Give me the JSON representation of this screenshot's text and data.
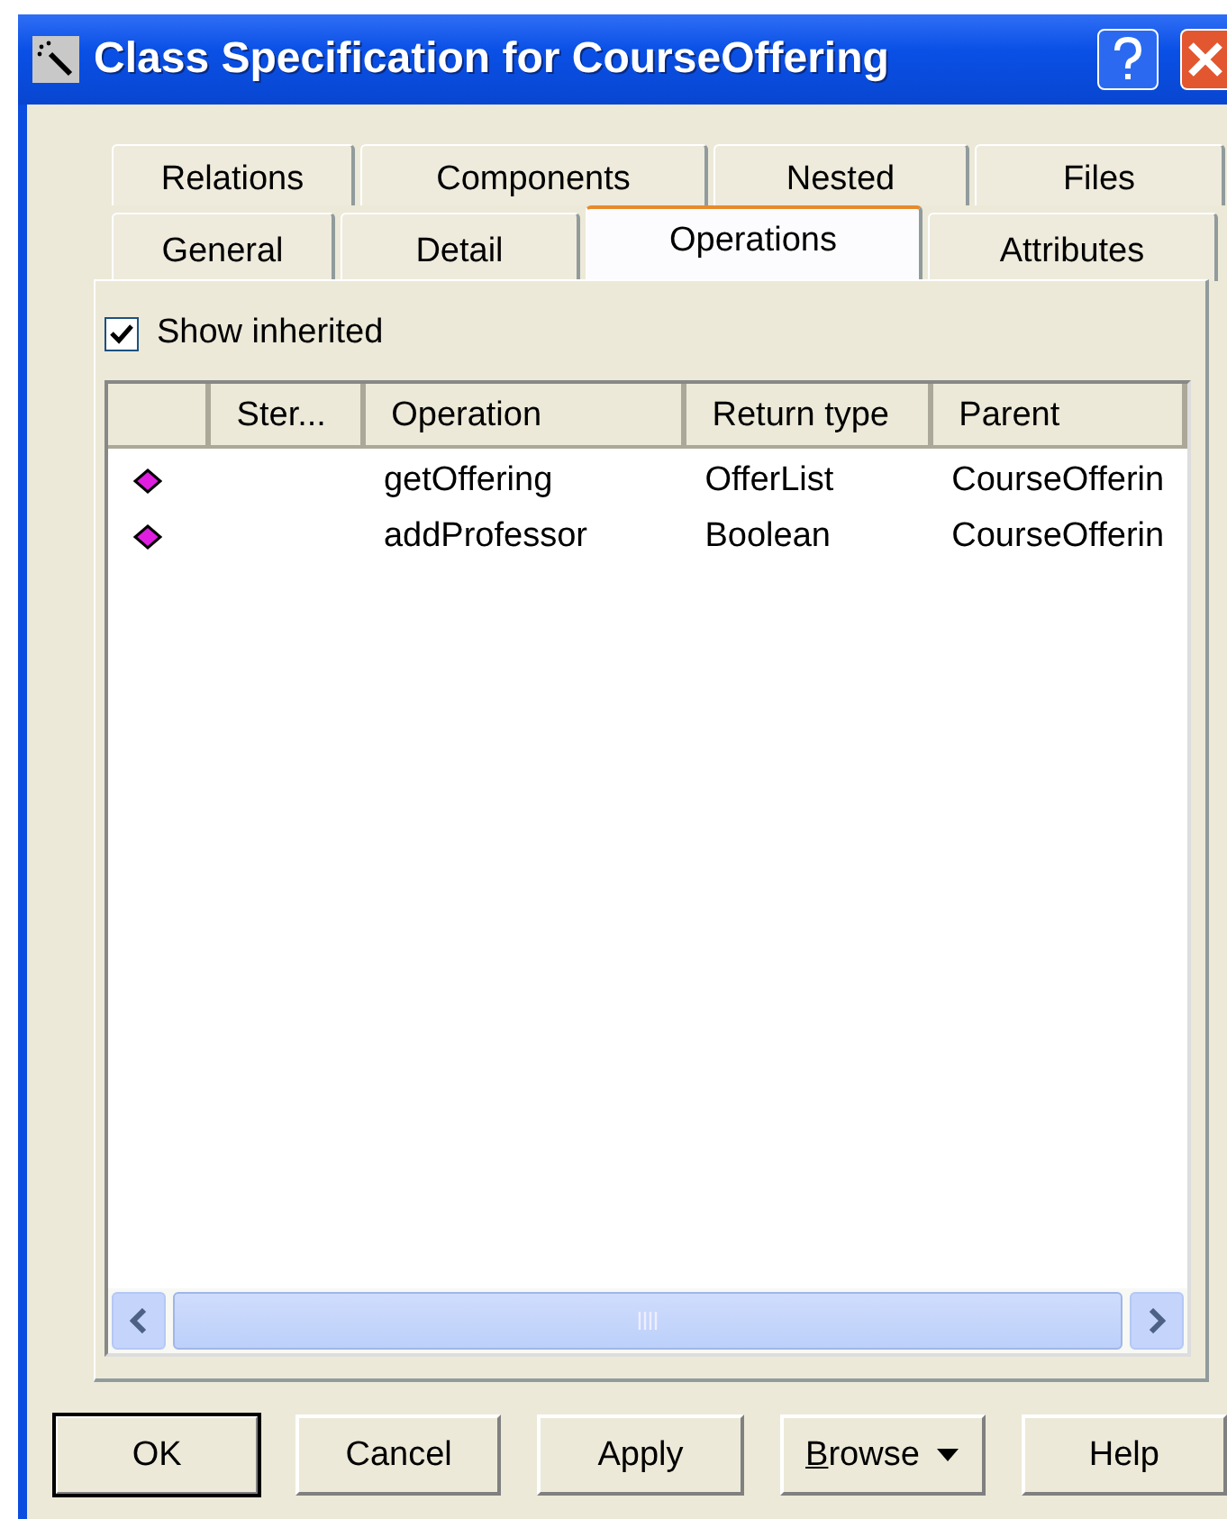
{
  "window": {
    "title": "Class Specification for CourseOffering"
  },
  "tab_rows": [
    [
      {
        "label": "Relations",
        "selected": false
      },
      {
        "label": "Components",
        "selected": false
      },
      {
        "label": "Nested",
        "selected": false
      },
      {
        "label": "Files",
        "selected": false
      }
    ],
    [
      {
        "label": "General",
        "selected": false
      },
      {
        "label": "Detail",
        "selected": false
      },
      {
        "label": "Operations",
        "selected": true
      },
      {
        "label": "Attributes",
        "selected": false
      }
    ]
  ],
  "show_inherited": {
    "label": "Show inherited",
    "checked": true
  },
  "table": {
    "columns": [
      "",
      "Ster...",
      "Operation",
      "Return type",
      "Parent"
    ],
    "rows": [
      {
        "operation": "getOffering",
        "return_type": "OfferList",
        "parent": "CourseOfferin"
      },
      {
        "operation": "addProfessor",
        "return_type": "Boolean",
        "parent": "CourseOfferin"
      }
    ]
  },
  "buttons": [
    {
      "label": "OK",
      "default": true,
      "dropdown": false
    },
    {
      "label": "Cancel",
      "default": false,
      "dropdown": false
    },
    {
      "label": "Apply",
      "default": false,
      "dropdown": false
    },
    {
      "label": "Browse",
      "default": false,
      "dropdown": true
    },
    {
      "label": "Help",
      "default": false,
      "dropdown": false
    }
  ]
}
